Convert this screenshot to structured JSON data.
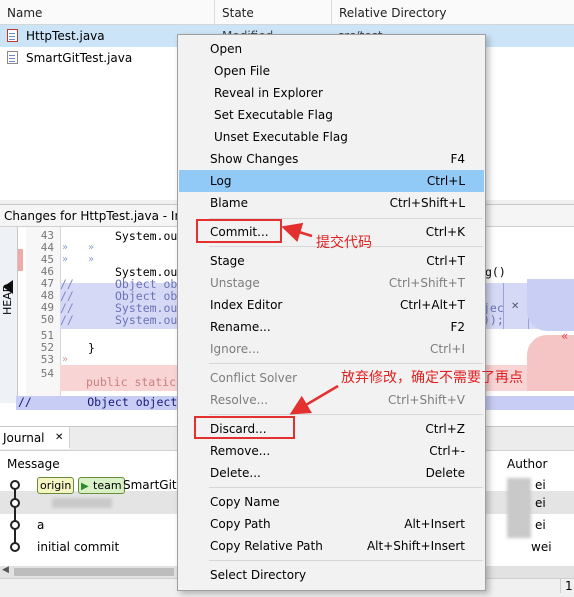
{
  "file_table": {
    "columns": [
      "Name",
      "State",
      "Relative Directory"
    ],
    "rows": [
      {
        "name": "HttpTest.java",
        "state": "Modified",
        "dir": "src/test",
        "selected": true
      },
      {
        "name": "SmartGitTest.java",
        "state": "",
        "dir": "",
        "selected": false
      }
    ]
  },
  "changes_panel": {
    "title": "Changes for HttpTest.java - In",
    "head_label": "HEAD",
    "lines": [
      {
        "no": "43",
        "text": "System.ou"
      },
      {
        "no": "44",
        "text": ""
      },
      {
        "no": "45",
        "text": ""
      },
      {
        "no": "46",
        "text": "System.ou"
      },
      {
        "no": "47",
        "text": "Object ob"
      },
      {
        "no": "48",
        "text": "Object ob"
      },
      {
        "no": "49",
        "text": "System.ou"
      },
      {
        "no": "50",
        "text": "System.ou"
      },
      {
        "no": "51",
        "text": ""
      },
      {
        "no": "52",
        "text": "}"
      },
      {
        "no": "53",
        "text": ""
      },
      {
        "no": "54",
        "text": "public static"
      }
    ],
    "right_fragments": [
      "g()",
      "jec",
      "));"
    ],
    "diff_line": "//        Object object ="
  },
  "journal": {
    "tab_label": "Journal",
    "col_message": "Message",
    "col_author": "Author",
    "rows": [
      {
        "message": "SmartGit",
        "author": "ei",
        "badges": [
          "origin",
          "team"
        ]
      },
      {
        "message": "",
        "author": "ei",
        "badges": []
      },
      {
        "message": "a",
        "author": "ei",
        "badges": []
      },
      {
        "message": "initial commit",
        "author": "wei",
        "badges": []
      }
    ],
    "status_number": "1"
  },
  "context_menu": {
    "items": [
      {
        "label": "Open",
        "shortcut": "",
        "disabled": false,
        "highlight": false,
        "indent": false
      },
      {
        "label": "Open File",
        "shortcut": "",
        "disabled": false,
        "highlight": false,
        "indent": true
      },
      {
        "label": "Reveal in Explorer",
        "shortcut": "",
        "disabled": false,
        "highlight": false,
        "indent": true
      },
      {
        "label": "Set Executable Flag",
        "shortcut": "",
        "disabled": false,
        "highlight": false,
        "indent": true
      },
      {
        "label": "Unset Executable Flag",
        "shortcut": "",
        "disabled": false,
        "highlight": false,
        "indent": true
      },
      {
        "label": "Show Changes",
        "shortcut": "F4",
        "disabled": false,
        "highlight": false,
        "indent": false
      },
      {
        "label": "Log",
        "shortcut": "Ctrl+L",
        "disabled": false,
        "highlight": true,
        "indent": false
      },
      {
        "label": "Blame",
        "shortcut": "Ctrl+Shift+L",
        "disabled": false,
        "highlight": false,
        "indent": false
      },
      {
        "label": "Commit...",
        "shortcut": "Ctrl+K",
        "disabled": false,
        "highlight": false,
        "indent": false
      },
      {
        "label": "Stage",
        "shortcut": "Ctrl+T",
        "disabled": false,
        "highlight": false,
        "indent": false
      },
      {
        "label": "Unstage",
        "shortcut": "Ctrl+Shift+T",
        "disabled": true,
        "highlight": false,
        "indent": false
      },
      {
        "label": "Index Editor",
        "shortcut": "Ctrl+Alt+T",
        "disabled": false,
        "highlight": false,
        "indent": false
      },
      {
        "label": "Rename...",
        "shortcut": "F2",
        "disabled": false,
        "highlight": false,
        "indent": false
      },
      {
        "label": "Ignore...",
        "shortcut": "Ctrl+I",
        "disabled": true,
        "highlight": false,
        "indent": false
      },
      {
        "label": "Conflict Solver",
        "shortcut": "",
        "disabled": true,
        "highlight": false,
        "indent": false
      },
      {
        "label": "Resolve...",
        "shortcut": "Ctrl+Shift+V",
        "disabled": true,
        "highlight": false,
        "indent": false
      },
      {
        "label": "Discard...",
        "shortcut": "Ctrl+Z",
        "disabled": false,
        "highlight": false,
        "indent": false
      },
      {
        "label": "Remove...",
        "shortcut": "Ctrl+-",
        "disabled": false,
        "highlight": false,
        "indent": false
      },
      {
        "label": "Delete...",
        "shortcut": "Delete",
        "disabled": false,
        "highlight": false,
        "indent": false
      },
      {
        "label": "Copy Name",
        "shortcut": "",
        "disabled": false,
        "highlight": false,
        "indent": false
      },
      {
        "label": "Copy Path",
        "shortcut": "Alt+Insert",
        "disabled": false,
        "highlight": false,
        "indent": false
      },
      {
        "label": "Copy Relative Path",
        "shortcut": "Alt+Shift+Insert",
        "disabled": false,
        "highlight": false,
        "indent": false
      },
      {
        "label": "Select Directory",
        "shortcut": "",
        "disabled": false,
        "highlight": false,
        "indent": false
      }
    ]
  },
  "annotations": {
    "commit_note": "提交代码",
    "discard_note": "放弃修改，确定不需要了再点"
  },
  "colors": {
    "highlight": "#91c9f7",
    "selection": "#cce4f7",
    "annotation_red": "#e53030",
    "diff_blue": "#d5d9f5",
    "diff_pink": "#f9d4d4"
  }
}
